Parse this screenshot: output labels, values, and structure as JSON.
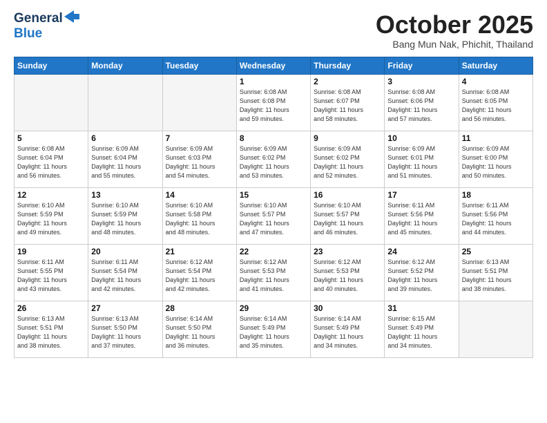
{
  "header": {
    "logo_general": "General",
    "logo_blue": "Blue",
    "month_title": "October 2025",
    "location": "Bang Mun Nak, Phichit, Thailand"
  },
  "weekdays": [
    "Sunday",
    "Monday",
    "Tuesday",
    "Wednesday",
    "Thursday",
    "Friday",
    "Saturday"
  ],
  "weeks": [
    [
      {
        "day": "",
        "info": ""
      },
      {
        "day": "",
        "info": ""
      },
      {
        "day": "",
        "info": ""
      },
      {
        "day": "1",
        "info": "Sunrise: 6:08 AM\nSunset: 6:08 PM\nDaylight: 11 hours\nand 59 minutes."
      },
      {
        "day": "2",
        "info": "Sunrise: 6:08 AM\nSunset: 6:07 PM\nDaylight: 11 hours\nand 58 minutes."
      },
      {
        "day": "3",
        "info": "Sunrise: 6:08 AM\nSunset: 6:06 PM\nDaylight: 11 hours\nand 57 minutes."
      },
      {
        "day": "4",
        "info": "Sunrise: 6:08 AM\nSunset: 6:05 PM\nDaylight: 11 hours\nand 56 minutes."
      }
    ],
    [
      {
        "day": "5",
        "info": "Sunrise: 6:08 AM\nSunset: 6:04 PM\nDaylight: 11 hours\nand 56 minutes."
      },
      {
        "day": "6",
        "info": "Sunrise: 6:09 AM\nSunset: 6:04 PM\nDaylight: 11 hours\nand 55 minutes."
      },
      {
        "day": "7",
        "info": "Sunrise: 6:09 AM\nSunset: 6:03 PM\nDaylight: 11 hours\nand 54 minutes."
      },
      {
        "day": "8",
        "info": "Sunrise: 6:09 AM\nSunset: 6:02 PM\nDaylight: 11 hours\nand 53 minutes."
      },
      {
        "day": "9",
        "info": "Sunrise: 6:09 AM\nSunset: 6:02 PM\nDaylight: 11 hours\nand 52 minutes."
      },
      {
        "day": "10",
        "info": "Sunrise: 6:09 AM\nSunset: 6:01 PM\nDaylight: 11 hours\nand 51 minutes."
      },
      {
        "day": "11",
        "info": "Sunrise: 6:09 AM\nSunset: 6:00 PM\nDaylight: 11 hours\nand 50 minutes."
      }
    ],
    [
      {
        "day": "12",
        "info": "Sunrise: 6:10 AM\nSunset: 5:59 PM\nDaylight: 11 hours\nand 49 minutes."
      },
      {
        "day": "13",
        "info": "Sunrise: 6:10 AM\nSunset: 5:59 PM\nDaylight: 11 hours\nand 48 minutes."
      },
      {
        "day": "14",
        "info": "Sunrise: 6:10 AM\nSunset: 5:58 PM\nDaylight: 11 hours\nand 48 minutes."
      },
      {
        "day": "15",
        "info": "Sunrise: 6:10 AM\nSunset: 5:57 PM\nDaylight: 11 hours\nand 47 minutes."
      },
      {
        "day": "16",
        "info": "Sunrise: 6:10 AM\nSunset: 5:57 PM\nDaylight: 11 hours\nand 46 minutes."
      },
      {
        "day": "17",
        "info": "Sunrise: 6:11 AM\nSunset: 5:56 PM\nDaylight: 11 hours\nand 45 minutes."
      },
      {
        "day": "18",
        "info": "Sunrise: 6:11 AM\nSunset: 5:56 PM\nDaylight: 11 hours\nand 44 minutes."
      }
    ],
    [
      {
        "day": "19",
        "info": "Sunrise: 6:11 AM\nSunset: 5:55 PM\nDaylight: 11 hours\nand 43 minutes."
      },
      {
        "day": "20",
        "info": "Sunrise: 6:11 AM\nSunset: 5:54 PM\nDaylight: 11 hours\nand 42 minutes."
      },
      {
        "day": "21",
        "info": "Sunrise: 6:12 AM\nSunset: 5:54 PM\nDaylight: 11 hours\nand 42 minutes."
      },
      {
        "day": "22",
        "info": "Sunrise: 6:12 AM\nSunset: 5:53 PM\nDaylight: 11 hours\nand 41 minutes."
      },
      {
        "day": "23",
        "info": "Sunrise: 6:12 AM\nSunset: 5:53 PM\nDaylight: 11 hours\nand 40 minutes."
      },
      {
        "day": "24",
        "info": "Sunrise: 6:12 AM\nSunset: 5:52 PM\nDaylight: 11 hours\nand 39 minutes."
      },
      {
        "day": "25",
        "info": "Sunrise: 6:13 AM\nSunset: 5:51 PM\nDaylight: 11 hours\nand 38 minutes."
      }
    ],
    [
      {
        "day": "26",
        "info": "Sunrise: 6:13 AM\nSunset: 5:51 PM\nDaylight: 11 hours\nand 38 minutes."
      },
      {
        "day": "27",
        "info": "Sunrise: 6:13 AM\nSunset: 5:50 PM\nDaylight: 11 hours\nand 37 minutes."
      },
      {
        "day": "28",
        "info": "Sunrise: 6:14 AM\nSunset: 5:50 PM\nDaylight: 11 hours\nand 36 minutes."
      },
      {
        "day": "29",
        "info": "Sunrise: 6:14 AM\nSunset: 5:49 PM\nDaylight: 11 hours\nand 35 minutes."
      },
      {
        "day": "30",
        "info": "Sunrise: 6:14 AM\nSunset: 5:49 PM\nDaylight: 11 hours\nand 34 minutes."
      },
      {
        "day": "31",
        "info": "Sunrise: 6:15 AM\nSunset: 5:49 PM\nDaylight: 11 hours\nand 34 minutes."
      },
      {
        "day": "",
        "info": ""
      }
    ]
  ]
}
